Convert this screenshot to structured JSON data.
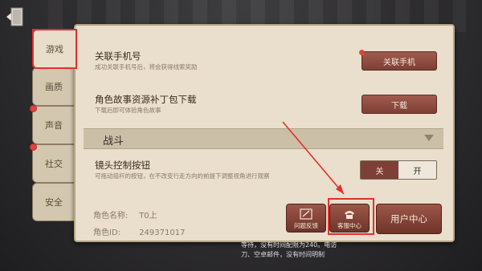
{
  "tabs": [
    {
      "label": "游戏",
      "active": true,
      "dot": false
    },
    {
      "label": "画质",
      "active": false,
      "dot": false
    },
    {
      "label": "声音",
      "active": false,
      "dot": true
    },
    {
      "label": "社交",
      "active": false,
      "dot": true
    },
    {
      "label": "安全",
      "active": false,
      "dot": false
    }
  ],
  "settings": {
    "phone": {
      "title": "关联手机号",
      "desc": "成功关联手机号后，将会获得线索奖励",
      "button": "关联手机"
    },
    "story": {
      "title": "角色故事资源补丁包下载",
      "desc": "下载后即可体验角色故事",
      "button": "下载"
    },
    "section": {
      "title": "战斗"
    },
    "camera": {
      "title": "镜头控制按钮",
      "desc": "可拖动摇杆的按钮，在不改变行走方向的前提下调整视角进行观察",
      "off": "关",
      "on": "开"
    }
  },
  "role": {
    "name_label": "角色名称:",
    "name_value": "T0上",
    "id_label": "角色ID:",
    "id_value": "249371017"
  },
  "buttons": {
    "feedback": "问题反馈",
    "service": "客服中心",
    "user_center": "用户中心"
  },
  "bottom_note": {
    "line1": "等待，没有时间配限为240。电访",
    "line2": "刀、空卓邮件，没有时间明制"
  },
  "colors": {
    "accent": "#e2312d",
    "button": "#8a4a40"
  }
}
